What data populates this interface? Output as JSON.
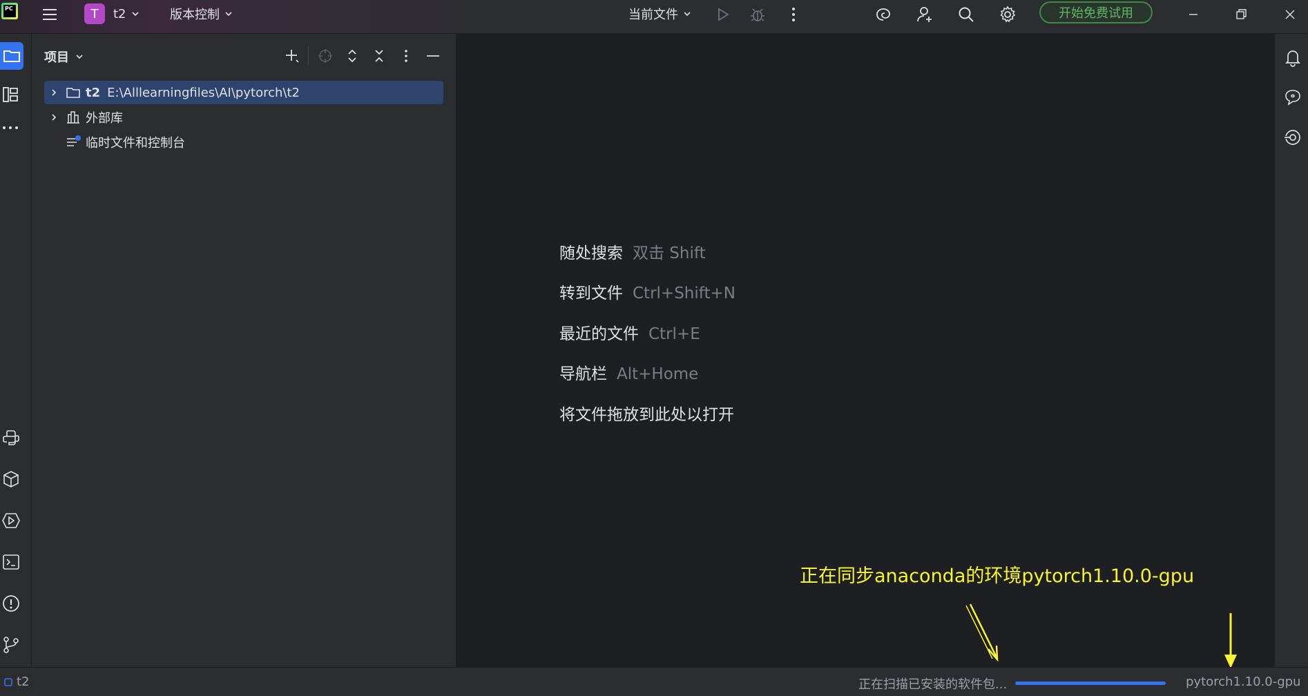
{
  "titlebar": {
    "app_logo_text": "PC",
    "project_avatar_letter": "T",
    "project_name": "t2",
    "vcs_menu": "版本控制",
    "run_config": "当前文件",
    "trial_button": "开始免费试用"
  },
  "project_panel": {
    "title": "项目",
    "tree": [
      {
        "bold": "t2",
        "label": "E:\\Alllearningfiles\\AI\\pytorch\\t2",
        "selected": true,
        "icon": "folder-icon"
      },
      {
        "label": "外部库",
        "icon": "library-icon"
      },
      {
        "label": "临时文件和控制台",
        "icon": "scratches-icon"
      }
    ]
  },
  "editor": {
    "hints": [
      {
        "label": "随处搜索",
        "key": "双击 Shift"
      },
      {
        "label": "转到文件",
        "key": "Ctrl+Shift+N"
      },
      {
        "label": "最近的文件",
        "key": "Ctrl+E"
      },
      {
        "label": "导航栏",
        "key": "Alt+Home"
      },
      {
        "label": "将文件拖放到此处以打开",
        "key": ""
      }
    ],
    "annotation": "正在同步anaconda的环境pytorch1.10.0-gpu"
  },
  "statusbar": {
    "project": "t2",
    "task_text": "正在扫描已安装的软件包...",
    "progress_percent": 100,
    "interpreter": "pytorch1.10.0-gpu"
  },
  "colors": {
    "accent": "#3574f0",
    "selection": "#2e436e",
    "trial_green": "#5fb865",
    "annotation_yellow": "#f7f23a",
    "avatar_purple": "#b349c4"
  }
}
